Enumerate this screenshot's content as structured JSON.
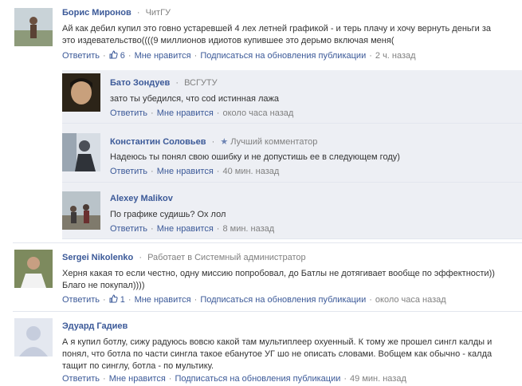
{
  "comments": [
    {
      "name": "Борис Миронов",
      "affiliation": "ЧитГУ",
      "text_lines": [
        "Ай как дебил купил это говно устаревшей 4 лех летней графикой - и терь плачу и хочу вернуть деньги за",
        "это издевательство((((9 миллионов идиотов купившее это дерьмо включая меня("
      ],
      "reply": "Ответить",
      "likes": "6",
      "like": "Мне нравится",
      "subscribe": "Подписаться на обновления публикации",
      "time": "2 ч. назад"
    },
    {
      "name": "Бато Зондуев",
      "affiliation": "ВСГУТУ",
      "text_lines": [
        "зато ты убедился, что cod истинная лажа"
      ],
      "reply": "Ответить",
      "like": "Мне нравится",
      "time": "около часа назад"
    },
    {
      "name": "Константин Соловьев",
      "affiliation": "Лучший комментатор",
      "text_lines": [
        "Надеюсь ты понял свою ошибку и не допустишь ее в следующем году)"
      ],
      "reply": "Ответить",
      "like": "Мне нравится",
      "time": "40 мин. назад"
    },
    {
      "name": "Alexey Malikov",
      "affiliation": "",
      "text_lines": [
        "По графике судишь? Ох лол"
      ],
      "reply": "Ответить",
      "like": "Мне нравится",
      "time": "8 мин. назад"
    },
    {
      "name": "Sergei Nikolenko",
      "affiliation": "Работает в Системный администратор",
      "text_lines": [
        "Херня какая то если честно, одну миссию попробовал, до Батлы не дотягивает вообще по эффектности))",
        "Благо не покупал))))"
      ],
      "reply": "Ответить",
      "likes": "1",
      "like": "Мне нравится",
      "subscribe": "Подписаться на обновления публикации",
      "time": "около часа назад"
    },
    {
      "name": "Эдуард Гадиев",
      "affiliation": "",
      "text_lines": [
        "А я купил ботлу, сижу радуюсь вовсю какой там мультиплеер охуенный. К тому же прошел сингл калды и",
        "понял, что ботла по части сингла такое ебанутое УГ шо не описать словами. Вобщем как обычно - калда",
        "тащит по синглу, ботла - по мультику."
      ],
      "reply": "Ответить",
      "like": "Мне нравится",
      "subscribe": "Подписаться на обновления публикации",
      "time": "49 мин. назад"
    }
  ],
  "colors": {
    "link": "#3b5998",
    "meta": "#808080",
    "reply_bg": "#edeff4"
  },
  "icons": {
    "like": "thumbs-up-icon",
    "star": "star-icon",
    "placeholder": "default-avatar-icon"
  }
}
